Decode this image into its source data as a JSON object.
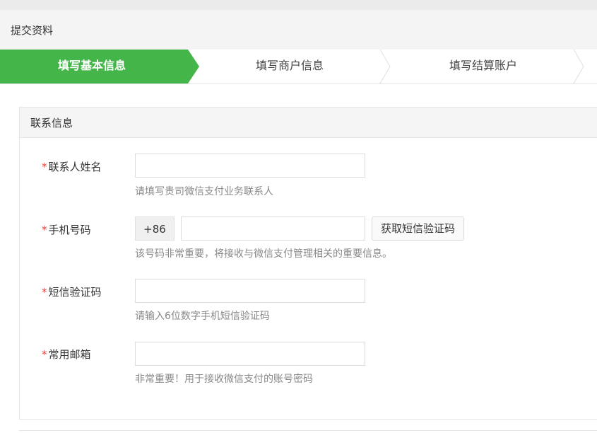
{
  "header": {
    "title": "提交资料"
  },
  "steps": [
    {
      "label": "填写基本信息",
      "active": true
    },
    {
      "label": "填写商户信息",
      "active": false
    },
    {
      "label": "填写结算账户",
      "active": false
    }
  ],
  "colors": {
    "active_step": "#44b549",
    "required": "#e5413f",
    "hint": "#888888"
  },
  "section": {
    "title": "联系信息"
  },
  "form": {
    "required_mark": "*",
    "contact_name": {
      "label": "联系人姓名",
      "value": "",
      "hint": "请填写贵司微信支付业务联系人"
    },
    "phone": {
      "label": "手机号码",
      "prefix": "+86",
      "value": "",
      "button": "获取短信验证码",
      "hint": "该号码非常重要，将接收与微信支付管理相关的重要信息。"
    },
    "sms_code": {
      "label": "短信验证码",
      "value": "",
      "hint": "请输入6位数字手机短信验证码"
    },
    "email": {
      "label": "常用邮箱",
      "value": "",
      "hint": "非常重要！用于接收微信支付的账号密码"
    }
  }
}
